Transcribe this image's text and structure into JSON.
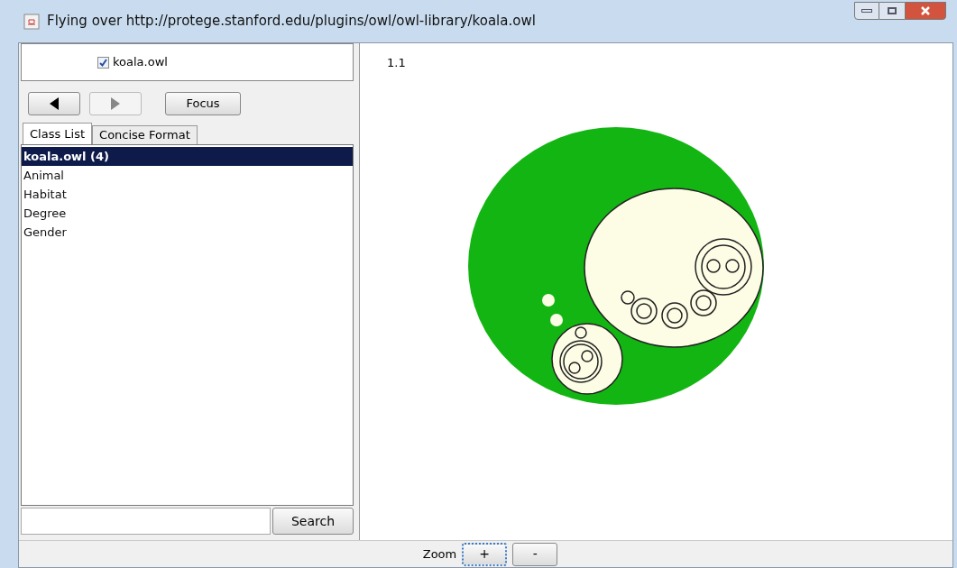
{
  "window": {
    "title": "Flying over http://protege.stanford.edu/plugins/owl/owl-library/koala.owl"
  },
  "ontology": {
    "label": "koala.owl",
    "checked": true
  },
  "nav": {
    "back_disabled": false,
    "forward_disabled": true,
    "focus": "Focus"
  },
  "tabs": [
    {
      "label": "Class List",
      "selected": true
    },
    {
      "label": "Concise Format",
      "selected": false
    }
  ],
  "classes": [
    {
      "label": "koala.owl (4)",
      "selected": true
    },
    {
      "label": "Animal",
      "selected": false
    },
    {
      "label": "Habitat",
      "selected": false
    },
    {
      "label": "Degree",
      "selected": false
    },
    {
      "label": "Gender",
      "selected": false
    }
  ],
  "search": {
    "button": "Search"
  },
  "canvas": {
    "label": "1.1"
  },
  "zoom": {
    "label": "Zoom",
    "buttons": [
      "+",
      "-"
    ]
  }
}
